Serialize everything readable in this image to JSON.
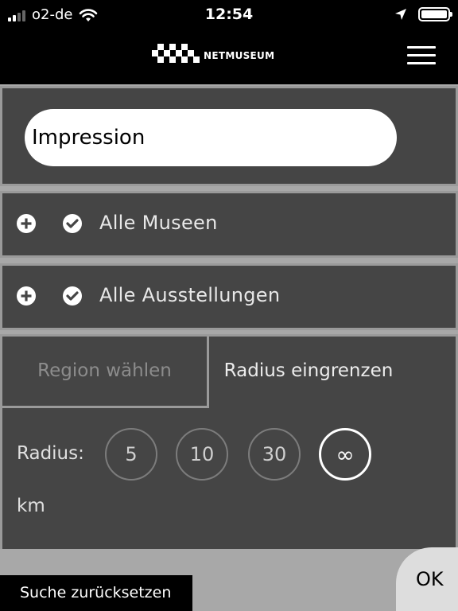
{
  "status_bar": {
    "carrier": "o2-de",
    "time": "12:54"
  },
  "header": {
    "logo_text": "NETMUSEUM"
  },
  "search": {
    "value": "Impression"
  },
  "filters": {
    "museums": {
      "label": "Alle Museen"
    },
    "exhibitions": {
      "label": "Alle Ausstellungen"
    }
  },
  "location": {
    "tab_region": "Region wählen",
    "tab_radius": "Radius eingrenzen",
    "radius_label": "Radius:",
    "unit": "km",
    "options": [
      "5",
      "10",
      "30",
      "∞"
    ],
    "selected": "∞"
  },
  "footer": {
    "reset_label": "Suche zurücksetzen",
    "ok_label": "OK"
  }
}
